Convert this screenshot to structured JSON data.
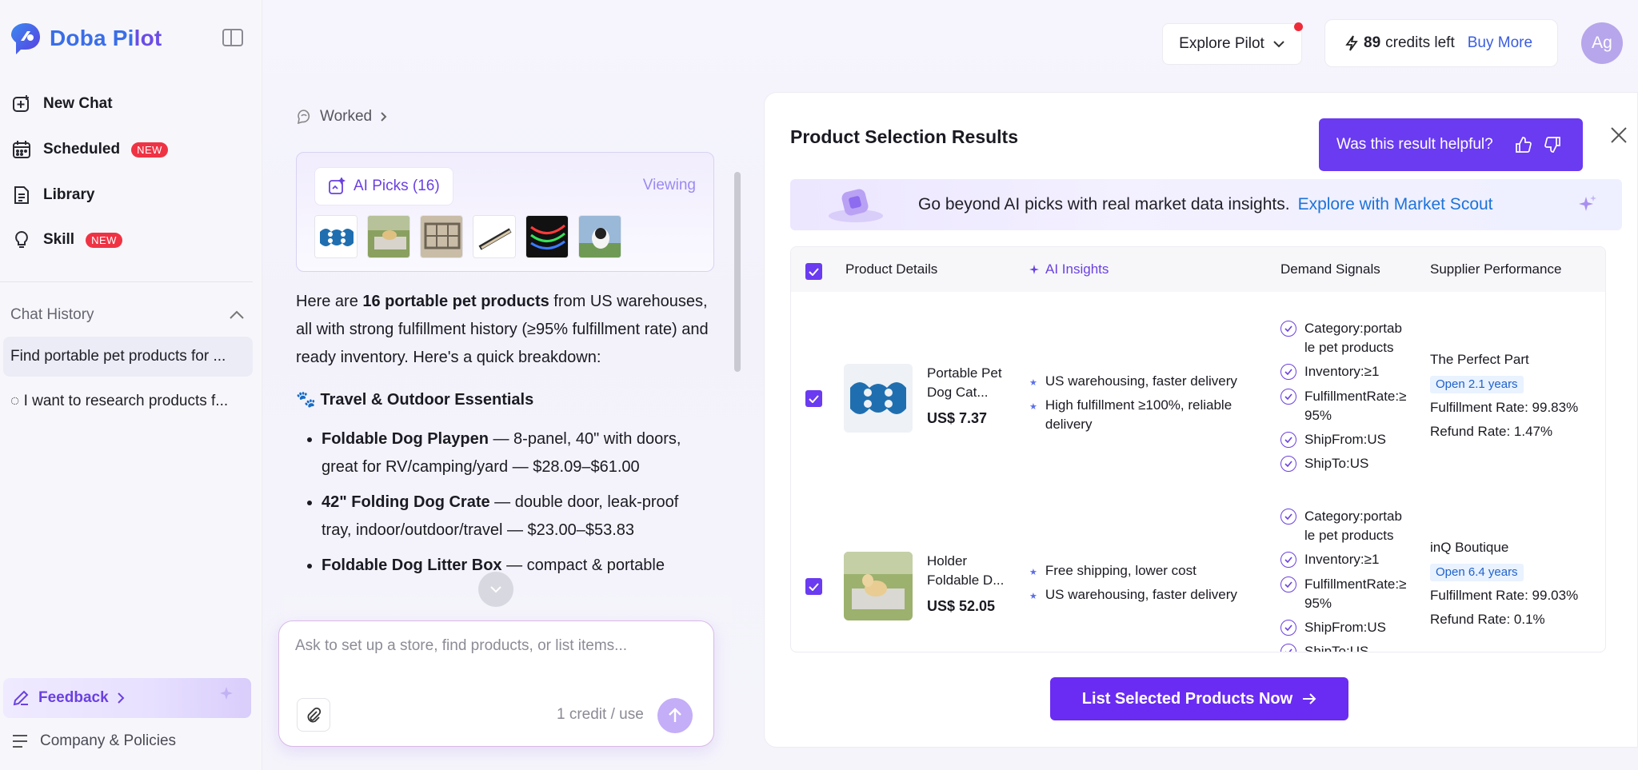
{
  "app": {
    "name_part1": "Doba Pi",
    "name_part2": "lot"
  },
  "sidebar": {
    "nav": [
      {
        "label": "New Chat"
      },
      {
        "label": "Scheduled",
        "badge": "NEW"
      },
      {
        "label": "Library"
      },
      {
        "label": "Skill",
        "badge": "NEW"
      }
    ],
    "history_title": "Chat History",
    "history": [
      {
        "label": "Find portable pet products for ..."
      },
      {
        "label": "◌ I want to research products f..."
      }
    ],
    "feedback_label": "Feedback",
    "company_label": "Company & Policies"
  },
  "topbar": {
    "explore_label": "Explore Pilot",
    "credits_num": "89",
    "credits_text": "credits left",
    "buy_more": "Buy More",
    "avatar_initials": "Ag"
  },
  "chat": {
    "worked_label": "Worked",
    "picks_label": "AI Picks (16)",
    "viewing_label": "Viewing",
    "intro_pre": "Here are ",
    "intro_bold": "16 portable pet products",
    "intro_post": " from US warehouses, all with strong fulfillment history (≥95% fulfillment rate) and ready inventory. Here's a quick breakdown:",
    "section_heading": "🐾 Travel & Outdoor Essentials",
    "bullets": [
      {
        "bold": "Foldable Dog Playpen",
        "rest": " — 8-panel, 40\" with doors, great for RV/camping/yard — $28.09–$61.00"
      },
      {
        "bold": "42\" Folding Dog Crate",
        "rest": " — double door, leak-proof tray, indoor/outdoor/travel — $23.00–$53.83"
      },
      {
        "bold": "Foldable Dog Litter Box",
        "rest": " — compact & portable"
      }
    ],
    "input_placeholder": "Ask to set up a store, find products, or list items...",
    "credit_use": "1 credit / use"
  },
  "results": {
    "title": "Product Selection Results",
    "helpful_label": "Was this result helpful?",
    "banner_text": "Go beyond AI picks with real market data insights.",
    "banner_link": "Explore with Market Scout",
    "columns": {
      "product": "Product Details",
      "insights": "AI Insights",
      "demand": "Demand Signals",
      "supplier": "Supplier Performance"
    },
    "rows": [
      {
        "name": "Portable Pet Dog Cat...",
        "price": "US$ 7.37",
        "insights": [
          "US warehousing, faster delivery",
          "High fulfillment ≥100%, reliable delivery"
        ],
        "signals": [
          "Category:portab le pet products",
          "Inventory:≥1",
          "FulfillmentRate:≥ 95%",
          "ShipFrom:US",
          "ShipTo:US"
        ],
        "supplier_name": "The Perfect Part",
        "open_years": "Open 2.1 years",
        "fulfillment_rate": "Fulfillment Rate: 99.83%",
        "refund_rate": "Refund Rate: 1.47%"
      },
      {
        "name": "Holder Foldable D...",
        "price": "US$ 52.05",
        "insights": [
          "Free shipping, lower cost",
          "US warehousing, faster delivery"
        ],
        "signals": [
          "Category:portab le pet products",
          "Inventory:≥1",
          "FulfillmentRate:≥ 95%",
          "ShipFrom:US",
          "ShipTo:US"
        ],
        "supplier_name": "inQ Boutique",
        "open_years": "Open 6.4 years",
        "fulfillment_rate": "Fulfillment Rate: 99.03%",
        "refund_rate": "Refund Rate: 0.1%"
      }
    ],
    "list_button": "List Selected Products Now"
  },
  "colors": {
    "accent": "#6a3bf0",
    "brand_blue": "#3a6ee8",
    "badge_red": "#ef3344",
    "link_blue": "#1d73d8"
  }
}
